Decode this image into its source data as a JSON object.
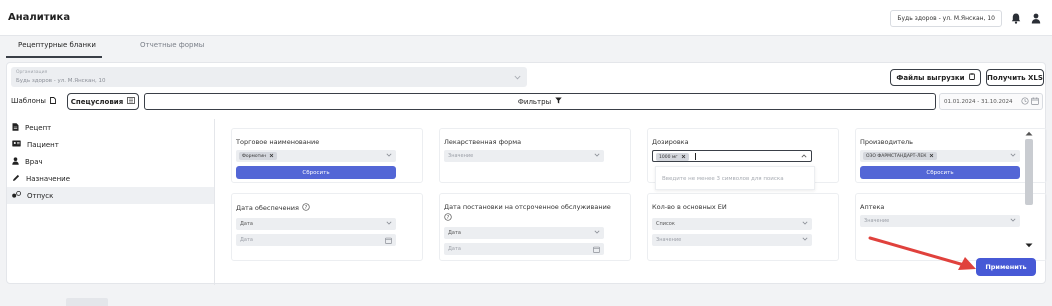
{
  "header": {
    "title": "Аналитика",
    "org_pill": "Будь здоров - ул. М.Янскан, 10"
  },
  "tabs": [
    {
      "label": "Рецептурные бланки",
      "active": true
    },
    {
      "label": "Отчетные формы",
      "active": false
    }
  ],
  "organization": {
    "label": "Организация",
    "value": "Будь здоров - ул. М.Янскан, 10"
  },
  "buttons": {
    "files": "Файлы выгрузки",
    "xls": "Получить XLS",
    "templates": "Шаблоны",
    "special": "Спецусловия",
    "filters": "Фильтры",
    "apply": "Применить"
  },
  "date_range": "01.01.2024 - 31.10.2024",
  "sidebar": [
    {
      "label": "Рецепт",
      "icon": "document-icon",
      "active": false
    },
    {
      "label": "Пациент",
      "icon": "id-card-icon",
      "active": false
    },
    {
      "label": "Врач",
      "icon": "person-icon",
      "active": false
    },
    {
      "label": "Назначение",
      "icon": "pen-icon",
      "active": false
    },
    {
      "label": "Отпуск",
      "icon": "pills-icon",
      "active": true
    }
  ],
  "filters": {
    "trade_name": {
      "label": "Торговое наименование",
      "chip": "Формотин",
      "reset": "Сбросить"
    },
    "dosage_form": {
      "label": "Лекарственная форма",
      "placeholder": "Значение"
    },
    "dosage": {
      "label": "Дозировка",
      "chip": "1000 мг",
      "hint": "Введите не менее 3 символов для поиска"
    },
    "manufacturer": {
      "label": "Производитель",
      "chip": "ОЗО ФАРМСТАНДАРТ-ЛЕК",
      "reset": "Сбросить"
    },
    "provision_date": {
      "label": "Дата обеспечения",
      "select": "Дата",
      "date_placeholder": "Дата"
    },
    "deferred_date": {
      "label": "Дата постановки на отсроченное обслуживание",
      "select": "Дата",
      "date_placeholder": "Дата"
    },
    "units": {
      "label": "Кол-во в основных ЕИ",
      "select": "Список",
      "placeholder": "Значение"
    },
    "pharmacy": {
      "label": "Аптека",
      "placeholder": "Значение"
    }
  },
  "colors": {
    "primary": "#4759D6",
    "arrow": "#E0413C"
  }
}
